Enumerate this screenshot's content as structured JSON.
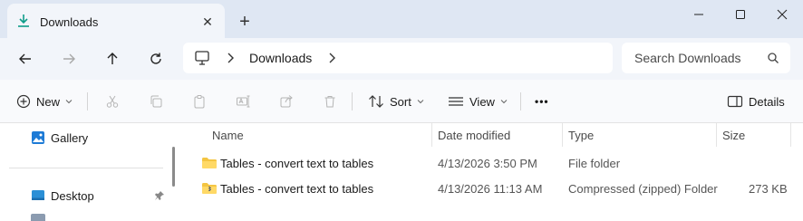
{
  "tab": {
    "title": "Downloads",
    "close": "✕",
    "new_tab": "+"
  },
  "window": {
    "minimize": "minimize",
    "maximize": "maximize",
    "close": "close"
  },
  "address": {
    "location": "Downloads",
    "search_placeholder": "Search Downloads"
  },
  "commands": {
    "new": "New",
    "sort": "Sort",
    "view": "View",
    "more": "•••",
    "details": "Details"
  },
  "sidebar": {
    "items": [
      {
        "label": "Gallery",
        "icon": "gallery-icon"
      },
      {
        "label": "Desktop",
        "icon": "desktop-icon",
        "pinned": true
      }
    ]
  },
  "columns": {
    "name": "Name",
    "date": "Date modified",
    "type": "Type",
    "size": "Size"
  },
  "files": [
    {
      "name": "Tables - convert text to tables",
      "date": "4/13/2026 3:50 PM",
      "type": "File folder",
      "size": "",
      "icon": "folder-icon"
    },
    {
      "name": "Tables - convert text to tables",
      "date": "4/13/2026 11:13 AM",
      "type": "Compressed (zipped) Folder",
      "size": "273 KB",
      "icon": "zip-folder-icon"
    }
  ],
  "colors": {
    "accent": "#0f9d8a",
    "folder": "#f4c542",
    "chrome": "#dfe7f3"
  }
}
